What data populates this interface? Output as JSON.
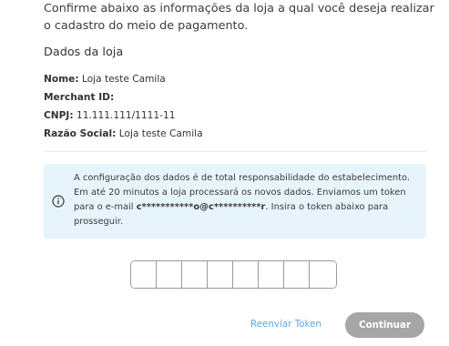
{
  "intro": {
    "text": "Confirme abaixo as informações da loja a qual você deseja realizar o cadastro do meio de pagamento."
  },
  "store": {
    "section_title": "Dados da loja",
    "name_label": "Nome:",
    "name_value": " Loja teste Camila",
    "merchant_label": "Merchant ID:",
    "merchant_value": "",
    "cnpj_label": "CNPJ:",
    "cnpj_value": " 11.111.111/1111-11",
    "razao_label": "Razão Social:",
    "razao_value": " Loja teste Camila"
  },
  "notice": {
    "icon": "info-circle-icon",
    "text_before": "A configuração dos dados é de total responsabilidade do estabelecimento. Em até 20 minutos a loja processará os novos dados. Enviamos um token para o e-mail ",
    "masked_email": "c***********o@c**********r",
    "text_after": ". Insira o token abaixo para prosseguir.",
    "bg_color": "#e8f4fc",
    "icon_color": "#3a3a3a"
  },
  "token": {
    "digits": [
      "",
      "",
      "",
      "",
      "",
      "",
      "",
      ""
    ]
  },
  "actions": {
    "resend_label": "Reenviar Token",
    "continue_label": "Continuar",
    "link_color": "#5aa9e6",
    "button_color": "#a6a6a6"
  }
}
